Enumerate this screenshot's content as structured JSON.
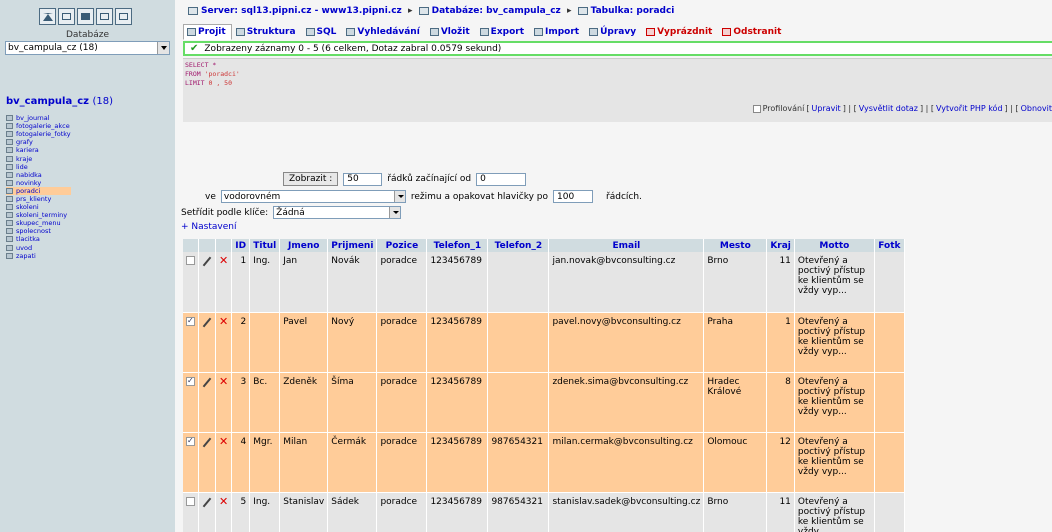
{
  "sidebar": {
    "databases_label": "Databáze",
    "db_select_value": "bv_campula_cz (18)",
    "db_title": "bv_campula_cz",
    "db_count": "(18)",
    "tables": [
      "bv_journal",
      "fotogalerie_akce",
      "fotogalerie_fotky",
      "grafy",
      "kariera",
      "kraje",
      "lide",
      "nabidka",
      "novinky",
      "poradci",
      "prs_klienty",
      "skoleni",
      "skoleni_terminy",
      "skupec_menu",
      "spolecnost",
      "tlacitka",
      "uvod",
      "zapati"
    ],
    "current_table": "poradci"
  },
  "breadcrumb": {
    "server": "Server: sql13.pipni.cz - www13.pipni.cz",
    "database": "Databáze: bv_campula_cz",
    "table": "Tabulka: poradci"
  },
  "tabs": [
    "Projit",
    "Struktura",
    "SQL",
    "Vyhledávání",
    "Vložit",
    "Export",
    "Import",
    "Úpravy",
    "Vyprázdnit",
    "Odstranit"
  ],
  "message": "Zobrazeny záznamy 0 - 5 (6 celkem, Dotaz zabral 0.0579 sekund)",
  "sql": {
    "line1": "SELECT *",
    "line2_kw": "FROM",
    "line2_val": "'poradci'",
    "line3_kw": "LIMIT",
    "line3_val": "0 , 50"
  },
  "sql_links": {
    "profiling": "Profilování",
    "edit": "Upravit",
    "explain": "Vysvětlit dotaz",
    "php": "Vytvořit PHP kód",
    "refresh": "Obnovit"
  },
  "navigation": {
    "show_button": "Zobrazit :",
    "rows_value": "50",
    "rows_from_label": "řádků začínající od",
    "start_value": "0",
    "in_label": "ve",
    "mode_value": "vodorovném",
    "mode_label": "režimu a opakovat hlavičky po",
    "repeat_value": "100",
    "rows_label": "řádcích.",
    "sort_label": "Setřídit podle klíče:",
    "sort_value": "Žádná",
    "settings_link": "+ Nastavení"
  },
  "columns": [
    "ID",
    "Titul",
    "Jmeno",
    "Prijmeni",
    "Pozice",
    "Telefon_1",
    "Telefon_2",
    "Email",
    "Mesto",
    "Kraj",
    "Motto",
    "Fotk"
  ],
  "rows": [
    {
      "id": "1",
      "titul": "Ing.",
      "jmeno": "Jan",
      "prijmeni": "Novák",
      "pozice": "poradce",
      "tel1": "123456789",
      "tel2": "",
      "email": "jan.novak@bvconsulting.cz",
      "mesto": "Brno",
      "kraj": "11",
      "motto": "Otevřený a poctivý přístup ke klientům se vždy vyp...",
      "marked": false
    },
    {
      "id": "2",
      "titul": "",
      "jmeno": "Pavel",
      "prijmeni": "Nový",
      "pozice": "poradce",
      "tel1": "123456789",
      "tel2": "",
      "email": "pavel.novy@bvconsulting.cz",
      "mesto": "Praha",
      "kraj": "1",
      "motto": "Otevřený a poctivý přístup ke klientům se vždy vyp...",
      "marked": true
    },
    {
      "id": "3",
      "titul": "Bc.",
      "jmeno": "Zdeněk",
      "prijmeni": "Šíma",
      "pozice": "poradce",
      "tel1": "123456789",
      "tel2": "",
      "email": "zdenek.sima@bvconsulting.cz",
      "mesto": "Hradec Králové",
      "kraj": "8",
      "motto": "Otevřený a poctivý přístup ke klientům se vždy vyp...",
      "marked": true
    },
    {
      "id": "4",
      "titul": "Mgr.",
      "jmeno": "Milan",
      "prijmeni": "Čermák",
      "pozice": "poradce",
      "tel1": "123456789",
      "tel2": "987654321",
      "email": "milan.cermak@bvconsulting.cz",
      "mesto": "Olomouc",
      "kraj": "12",
      "motto": "Otevřený a poctivý přístup ke klientům se vždy vyp...",
      "marked": true
    },
    {
      "id": "5",
      "titul": "Ing.",
      "jmeno": "Stanislav",
      "prijmeni": "Sádek",
      "pozice": "poradce",
      "tel1": "123456789",
      "tel2": "987654321",
      "email": "stanislav.sadek@bvconsulting.cz",
      "mesto": "Brno",
      "kraj": "11",
      "motto": "Otevřený a poctivý přístup ke klientům se vždy",
      "marked": false
    }
  ],
  "colors": {
    "sidebar_bg": "#d0dce0",
    "marked_row": "#ffcc99",
    "link": "#0000cc",
    "success_border": "#66dd66"
  }
}
